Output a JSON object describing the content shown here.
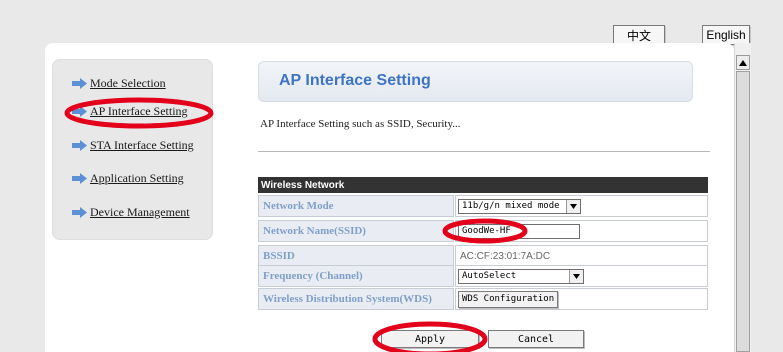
{
  "language": {
    "chinese_label": "中文",
    "english_label": "English"
  },
  "sidebar": {
    "items": [
      {
        "label": "Mode Selection"
      },
      {
        "label": "AP Interface Setting"
      },
      {
        "label": "STA Interface Setting"
      },
      {
        "label": "Application Setting"
      },
      {
        "label": "Device Management"
      }
    ]
  },
  "header": {
    "title": "AP Interface Setting",
    "description": "AP Interface Setting such as SSID, Security..."
  },
  "wireless": {
    "section_title": "Wireless Network",
    "rows": [
      {
        "label": "Network Mode",
        "value": "11b/g/n mixed mode"
      },
      {
        "label": "Network Name(SSID)",
        "value": "GoodWe-HF"
      },
      {
        "label": "BSSID",
        "value": "AC:CF:23:01:7A:DC"
      },
      {
        "label": "Frequency (Channel)",
        "value": "AutoSelect"
      },
      {
        "label": "Wireless Distribution System(WDS)",
        "value": "WDS Configuration"
      }
    ]
  },
  "actions": {
    "apply_label": "Apply",
    "cancel_label": "Cancel"
  },
  "colors": {
    "annotation": "#e2001a",
    "title_blue": "#3e74c2",
    "label_blue": "#7f9ec9",
    "nav_arrow": "#5b8fd6",
    "table_header": "#333333"
  },
  "icons": [
    "arrow-right-icon",
    "chevron-down-icon",
    "scroll-up-icon"
  ]
}
